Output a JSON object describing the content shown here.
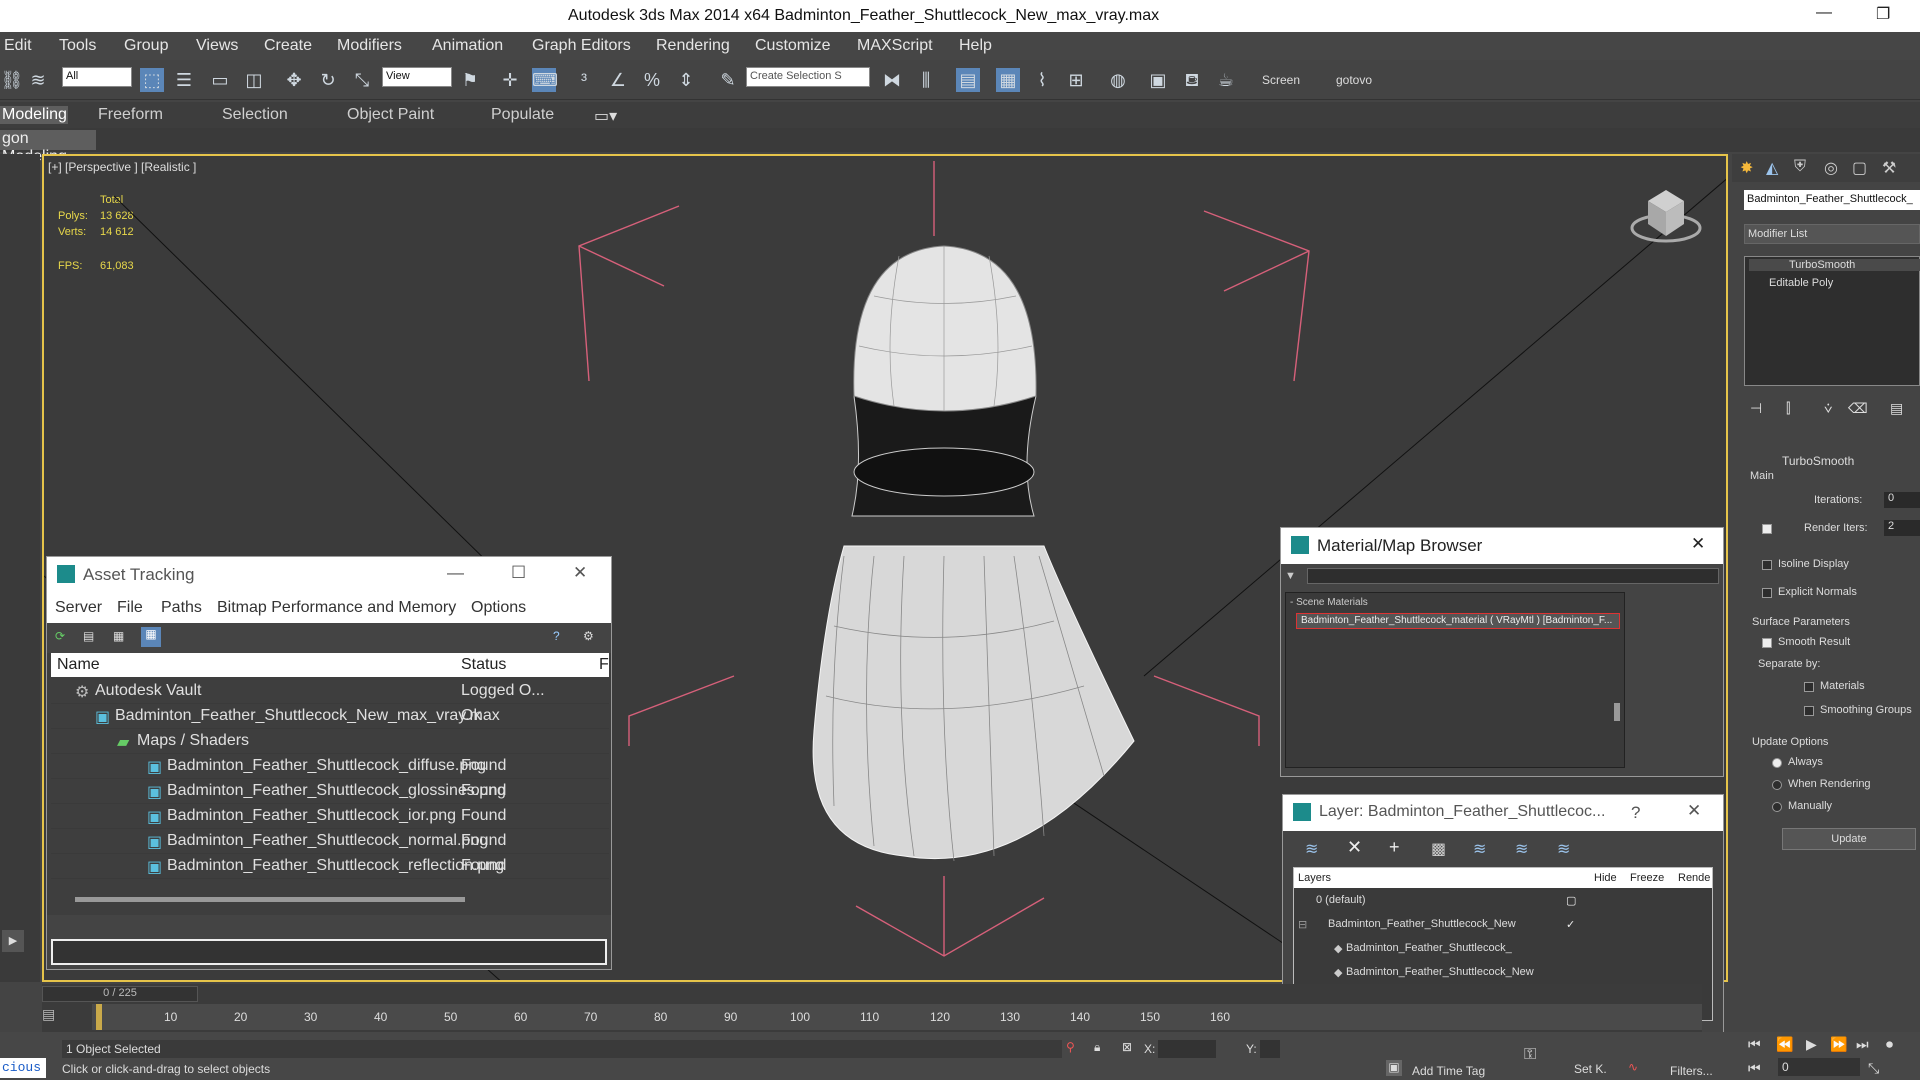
{
  "window": {
    "title": "Autodesk 3ds Max  2014 x64     Badminton_Feather_Shuttlecock_New_max_vray.max",
    "minimize_label": "—",
    "maximize_label": "❐"
  },
  "menu": [
    "Edit",
    "Tools",
    "Group",
    "Views",
    "Create",
    "Modifiers",
    "Animation",
    "Graph Editors",
    "Rendering",
    "Customize",
    "MAXScript",
    "Help"
  ],
  "toolbar": {
    "filter_select": "All",
    "ref_coord_select": "View",
    "named_selection_placeholder": "Create Selection S",
    "screen_label": "Screen",
    "gotovo_label": "gotovo"
  },
  "ribbon": {
    "tabs": [
      "Modeling",
      "Freeform",
      "Selection",
      "Object Paint",
      "Populate"
    ],
    "subtab": "gon Modeling"
  },
  "viewport": {
    "label": "[+] [Perspective ] [Realistic ]",
    "stats": {
      "total_label": "Total",
      "polys_label": "Polys:",
      "polys_value": "13 628",
      "verts_label": "Verts:",
      "verts_value": "14 612",
      "fps_label": "FPS:",
      "fps_value": "61,083"
    }
  },
  "asset_tracking": {
    "title": "Asset Tracking",
    "menu": [
      "Server",
      "File",
      "Paths",
      "Bitmap Performance and Memory",
      "Options"
    ],
    "col_name": "Name",
    "col_status": "Status",
    "col_extra": "F",
    "rows": [
      {
        "name": "Autodesk Vault",
        "status": "Logged O..."
      },
      {
        "name": "Badminton_Feather_Shuttlecock_New_max_vray.max",
        "status": "Ok"
      },
      {
        "name": "Maps / Shaders",
        "status": ""
      },
      {
        "name": "Badminton_Feather_Shuttlecock_diffuse.png",
        "status": "Found"
      },
      {
        "name": "Badminton_Feather_Shuttlecock_glossines.png",
        "status": "Found"
      },
      {
        "name": "Badminton_Feather_Shuttlecock_ior.png",
        "status": "Found"
      },
      {
        "name": "Badminton_Feather_Shuttlecock_normal.png",
        "status": "Found"
      },
      {
        "name": "Badminton_Feather_Shuttlecock_reflection.png",
        "status": "Found"
      }
    ]
  },
  "material_browser": {
    "title": "Material/Map Browser",
    "section": "- Scene Materials",
    "item": "Badminton_Feather_Shuttlecock_material  ( VRayMtl ) [Badminton_F..."
  },
  "layer_dialog": {
    "title": "Layer: Badminton_Feather_Shuttlecoc...",
    "help": "?",
    "col_layers": "Layers",
    "col_hide": "Hide",
    "col_freeze": "Freeze",
    "col_render": "Rende",
    "rows": [
      {
        "name": "0 (default)"
      },
      {
        "name": "Badminton_Feather_Shuttlecock_New"
      },
      {
        "name": "Badminton_Feather_Shuttlecock_"
      },
      {
        "name": "Badminton_Feather_Shuttlecock_New"
      }
    ]
  },
  "command_panel": {
    "object_name": "Badminton_Feather_Shuttlecock_",
    "modifier_list": "Modifier List",
    "stack": [
      "TurboSmooth",
      "Editable Poly"
    ],
    "rollout_title": "TurboSmooth",
    "main_label": "Main",
    "iterations_label": "Iterations:",
    "iterations_value": "0",
    "render_iters_label": "Render Iters:",
    "render_iters_value": "2",
    "isoline_label": "Isoline Display",
    "explicit_normals_label": "Explicit Normals",
    "surface_params_label": "Surface Parameters",
    "smooth_result_label": "Smooth Result",
    "separate_by_label": "Separate by:",
    "materials_label": "Materials",
    "smoothing_groups_label": "Smoothing Groups",
    "update_options_label": "Update Options",
    "always_label": "Always",
    "when_rendering_label": "When Rendering",
    "manually_label": "Manually",
    "update_button": "Update"
  },
  "timeline": {
    "frame_counter": "0 / 225",
    "ticks": [
      "10",
      "20",
      "30",
      "40",
      "50",
      "60",
      "70",
      "80",
      "90",
      "100",
      "110",
      "120",
      "130",
      "140",
      "150",
      "160"
    ]
  },
  "status": {
    "selected": "1 Object Selected",
    "prompt": "Click or click-and-drag to select objects",
    "maxscript": "cious",
    "x_label": "X:",
    "y_label": "Y:",
    "add_time_tag": "Add Time Tag",
    "set_key": "Set K.",
    "filters": "Filters...",
    "frame_value": "0"
  }
}
